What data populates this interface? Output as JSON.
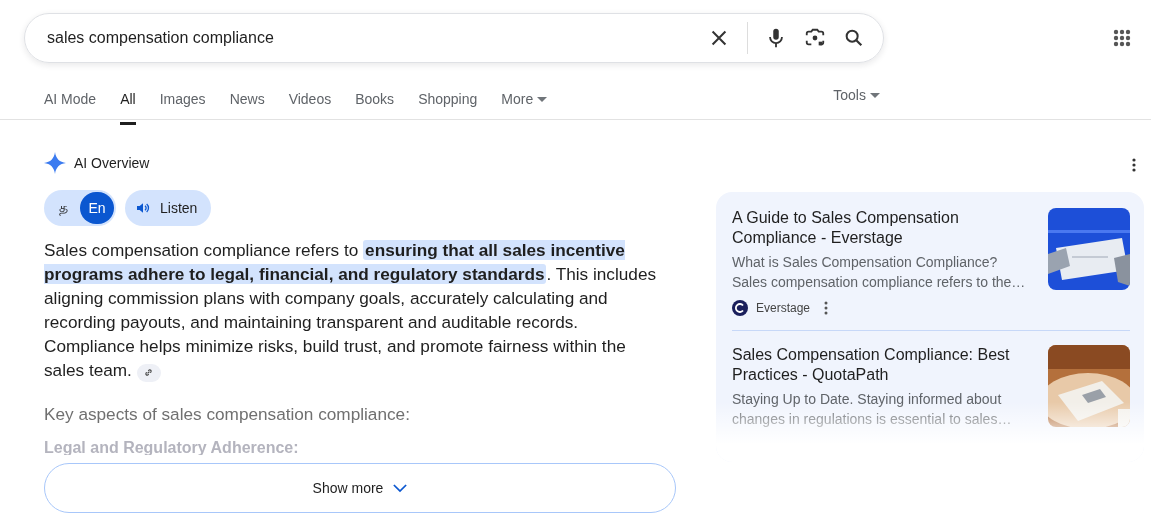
{
  "search": {
    "value": "sales compensation compliance"
  },
  "tabs": [
    {
      "label": "AI Mode",
      "selected": false
    },
    {
      "label": "All",
      "selected": true
    },
    {
      "label": "Images",
      "selected": false
    },
    {
      "label": "News",
      "selected": false
    },
    {
      "label": "Videos",
      "selected": false
    },
    {
      "label": "Books",
      "selected": false
    },
    {
      "label": "Shopping",
      "selected": false
    },
    {
      "label": "More",
      "selected": false,
      "kind": "menu"
    }
  ],
  "tools": {
    "label": "Tools"
  },
  "overview": {
    "title": "AI Overview",
    "languages": [
      {
        "label": "த",
        "selected": false
      },
      {
        "label": "En",
        "selected": true
      }
    ],
    "listen": "Listen",
    "answer": "Sales compensation compliance refers to **ensuring that all sales incentive programs adhere to legal, financial, and regulatory standards**. This includes aligning commission plans with company goals, accurately calculating and recording payouts, and maintaining transparent and auditable records. Compliance helps minimize risks, build trust, and promote fairness within the sales team.",
    "heading": "Key aspects of sales compensation compliance:",
    "subheading": "Legal and Regulatory Adherence:",
    "show_more": "Show more"
  },
  "sources": [
    {
      "title": "A Guide to Sales Compensation Compliance - Everstage",
      "snippet": "What is Sales Compensation Compliance? Sales compensation compliance refers to the…",
      "site": "Everstage",
      "kind": "picture"
    },
    {
      "title": "Sales Compensation Compliance: Best Practices - QuotaPath",
      "snippet": "Staying Up to Date. Staying informed about changes in regulations is essential to sales…",
      "kind": "picture"
    }
  ]
}
